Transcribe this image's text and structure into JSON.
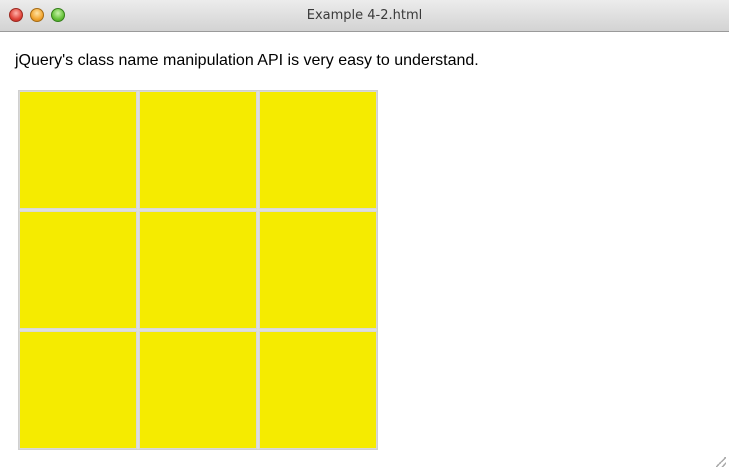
{
  "window": {
    "title": "Example 4-2.html"
  },
  "content": {
    "intro_text": "jQuery's class name manipulation API is very easy to understand."
  },
  "grid": {
    "rows": 3,
    "columns": 3,
    "cell_color": "#f5eb00"
  },
  "colors": {
    "titlebar": "#d8d8d8",
    "close": "#e0443a",
    "minimize": "#f2a632",
    "zoom": "#67c23a"
  }
}
